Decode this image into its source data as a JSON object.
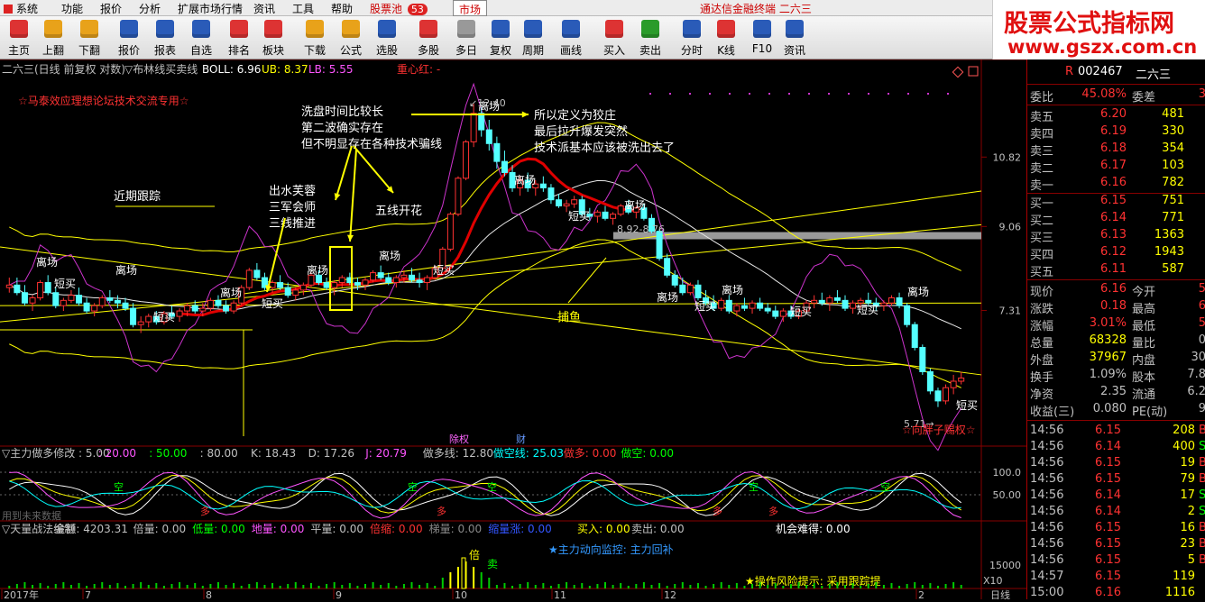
{
  "menu": {
    "items": [
      "系统",
      "功能",
      "报价",
      "分析",
      "扩展市场行情",
      "资讯",
      "工具",
      "帮助"
    ],
    "pool_label": "股票池",
    "pool_badge": "53",
    "market_tab": "市场",
    "window_title": "通达信金融终端 二六三"
  },
  "brand": {
    "title": "股票公式指标网",
    "url": "www.gszx.com.cn"
  },
  "toolbar": [
    {
      "label": "主页",
      "icon": "home-icon",
      "color": "#d33"
    },
    {
      "label": "上翻",
      "icon": "arrow-up-icon",
      "color": "#e8a21a"
    },
    {
      "label": "下翻",
      "icon": "arrow-down-icon",
      "color": "#e8a21a"
    },
    {
      "label": "报价",
      "icon": "quote-icon",
      "color": "#2a5bb8"
    },
    {
      "label": "报表",
      "icon": "report-icon",
      "color": "#2a5bb8"
    },
    {
      "label": "自选",
      "icon": "f6-icon",
      "color": "#2a5bb8"
    },
    {
      "label": "排名",
      "icon": "rank-icon",
      "color": "#d33"
    },
    {
      "label": "板块",
      "icon": "sector-icon",
      "color": "#d33"
    },
    {
      "label": "下载",
      "icon": "download-icon",
      "color": "#e8a21a"
    },
    {
      "label": "公式",
      "icon": "formula-icon",
      "color": "#e8a21a"
    },
    {
      "label": "选股",
      "icon": "stock-select-icon",
      "color": "#2a5bb8"
    },
    {
      "label": "多股",
      "icon": "multi-stock-icon",
      "color": "#d33"
    },
    {
      "label": "多日",
      "icon": "multi-day-icon",
      "color": "#999"
    },
    {
      "label": "复权",
      "icon": "restore-right-icon",
      "color": "#2a5bb8"
    },
    {
      "label": "周期",
      "icon": "f8-icon",
      "color": "#2a5bb8"
    },
    {
      "label": "画线",
      "icon": "draw-line-icon",
      "color": "#2a5bb8"
    },
    {
      "label": "买入",
      "icon": "buy-icon",
      "color": "#d33"
    },
    {
      "label": "卖出",
      "icon": "sell-icon",
      "color": "#2a9b2a"
    },
    {
      "label": "分时",
      "icon": "intraday-icon",
      "color": "#2a5bb8"
    },
    {
      "label": "K线",
      "icon": "kline-icon",
      "color": "#d33"
    },
    {
      "label": "F10",
      "icon": "f10-icon",
      "color": "#2a5bb8"
    },
    {
      "label": "资讯",
      "icon": "news-icon",
      "color": "#2a5bb8"
    }
  ],
  "main_chart": {
    "header": {
      "title": "二六三(日线 前复权 对数)",
      "indicator": "▽布林线买卖线",
      "boll": "BOLL: 6.96",
      "ub": "UB: 8.37",
      "lb": "LB: 5.55",
      "center": "重心红: -"
    },
    "watermark": "☆马泰效应理想论坛技术交流专用☆",
    "price_labels": [
      "10.82",
      "9.06",
      "7.31"
    ],
    "annotations": [
      "洗盘时间比较长",
      "第二波确实存在",
      "但不明显存在各种技术骗线",
      "所以定义为狡庄",
      "最后拉升爆发突然",
      "技术派基本应该被洗出去了",
      "近期跟踪",
      "出水芙蓉",
      "三军会师",
      "三线推进",
      "五线开花",
      "捕鱼"
    ],
    "high_label": "12.40",
    "range_label": "8.92-8.76",
    "low_label": "5.71",
    "bottom_tag": "☆向胖子赐权☆",
    "signal_sell": "离场",
    "signal_buy": "短买",
    "event_marks": [
      "除权",
      "财"
    ]
  },
  "chart_data": {
    "type": "candlestick",
    "title": "二六三(日线 前复权 对数)",
    "y_ticks": [
      10.82,
      9.06,
      7.31
    ],
    "candles": [
      {
        "o": 7.75,
        "h": 7.95,
        "l": 7.65,
        "c": 7.8
      },
      {
        "o": 7.8,
        "h": 7.95,
        "l": 7.6,
        "c": 7.65
      },
      {
        "o": 7.65,
        "h": 7.8,
        "l": 7.4,
        "c": 7.45
      },
      {
        "o": 7.45,
        "h": 7.6,
        "l": 7.3,
        "c": 7.55
      },
      {
        "o": 7.55,
        "h": 7.9,
        "l": 7.5,
        "c": 7.85
      },
      {
        "o": 7.85,
        "h": 8.0,
        "l": 7.6,
        "c": 7.65
      },
      {
        "o": 7.65,
        "h": 7.75,
        "l": 7.35,
        "c": 7.4
      },
      {
        "o": 7.4,
        "h": 7.55,
        "l": 7.3,
        "c": 7.5
      },
      {
        "o": 7.5,
        "h": 7.7,
        "l": 7.45,
        "c": 7.6
      },
      {
        "o": 7.6,
        "h": 7.75,
        "l": 7.4,
        "c": 7.45
      },
      {
        "o": 7.45,
        "h": 7.55,
        "l": 7.25,
        "c": 7.3
      },
      {
        "o": 7.3,
        "h": 7.45,
        "l": 7.2,
        "c": 7.4
      },
      {
        "o": 7.4,
        "h": 7.6,
        "l": 7.35,
        "c": 7.55
      },
      {
        "o": 7.55,
        "h": 7.7,
        "l": 7.45,
        "c": 7.5
      },
      {
        "o": 7.5,
        "h": 7.6,
        "l": 7.35,
        "c": 7.45
      },
      {
        "o": 7.45,
        "h": 7.55,
        "l": 7.3,
        "c": 7.35
      },
      {
        "o": 7.35,
        "h": 7.45,
        "l": 7.0,
        "c": 7.05
      },
      {
        "o": 7.05,
        "h": 7.2,
        "l": 6.9,
        "c": 7.1
      },
      {
        "o": 7.1,
        "h": 7.25,
        "l": 7.0,
        "c": 7.2
      },
      {
        "o": 7.2,
        "h": 7.3,
        "l": 7.05,
        "c": 7.1
      },
      {
        "o": 7.1,
        "h": 7.3,
        "l": 7.05,
        "c": 7.25
      },
      {
        "o": 7.25,
        "h": 7.4,
        "l": 7.15,
        "c": 7.2
      },
      {
        "o": 7.2,
        "h": 7.35,
        "l": 7.1,
        "c": 7.3
      },
      {
        "o": 7.3,
        "h": 7.45,
        "l": 7.2,
        "c": 7.4
      },
      {
        "o": 7.4,
        "h": 7.5,
        "l": 7.25,
        "c": 7.3
      },
      {
        "o": 7.3,
        "h": 7.45,
        "l": 7.2,
        "c": 7.35
      },
      {
        "o": 7.35,
        "h": 7.55,
        "l": 7.3,
        "c": 7.5
      },
      {
        "o": 7.5,
        "h": 7.6,
        "l": 7.35,
        "c": 7.4
      },
      {
        "o": 7.4,
        "h": 7.5,
        "l": 7.25,
        "c": 7.3
      },
      {
        "o": 7.3,
        "h": 7.5,
        "l": 7.25,
        "c": 7.45
      },
      {
        "o": 7.45,
        "h": 7.8,
        "l": 7.4,
        "c": 7.75
      },
      {
        "o": 7.75,
        "h": 8.15,
        "l": 7.7,
        "c": 8.1
      },
      {
        "o": 8.1,
        "h": 8.25,
        "l": 7.9,
        "c": 7.95
      },
      {
        "o": 7.95,
        "h": 8.05,
        "l": 7.7,
        "c": 7.75
      },
      {
        "o": 7.75,
        "h": 7.9,
        "l": 7.65,
        "c": 7.85
      },
      {
        "o": 7.85,
        "h": 8.0,
        "l": 7.7,
        "c": 7.75
      },
      {
        "o": 7.75,
        "h": 7.85,
        "l": 7.55,
        "c": 7.6
      },
      {
        "o": 7.6,
        "h": 7.75,
        "l": 7.5,
        "c": 7.7
      },
      {
        "o": 7.7,
        "h": 7.85,
        "l": 7.6,
        "c": 7.8
      },
      {
        "o": 7.8,
        "h": 8.05,
        "l": 7.75,
        "c": 8.0
      },
      {
        "o": 8.0,
        "h": 8.1,
        "l": 7.8,
        "c": 7.85
      },
      {
        "o": 7.85,
        "h": 7.95,
        "l": 7.7,
        "c": 7.75
      },
      {
        "o": 7.75,
        "h": 7.9,
        "l": 7.6,
        "c": 7.85
      },
      {
        "o": 7.85,
        "h": 8.0,
        "l": 7.75,
        "c": 7.95
      },
      {
        "o": 7.95,
        "h": 8.05,
        "l": 7.8,
        "c": 7.85
      },
      {
        "o": 7.85,
        "h": 7.95,
        "l": 7.7,
        "c": 7.8
      },
      {
        "o": 7.8,
        "h": 7.95,
        "l": 7.7,
        "c": 7.9
      },
      {
        "o": 7.9,
        "h": 8.1,
        "l": 7.85,
        "c": 8.05
      },
      {
        "o": 8.05,
        "h": 8.2,
        "l": 7.9,
        "c": 7.95
      },
      {
        "o": 7.95,
        "h": 8.05,
        "l": 7.8,
        "c": 7.85
      },
      {
        "o": 7.85,
        "h": 8.0,
        "l": 7.75,
        "c": 7.95
      },
      {
        "o": 7.95,
        "h": 8.1,
        "l": 7.85,
        "c": 8.0
      },
      {
        "o": 8.0,
        "h": 8.15,
        "l": 7.85,
        "c": 7.9
      },
      {
        "o": 7.9,
        "h": 8.05,
        "l": 7.75,
        "c": 7.85
      },
      {
        "o": 7.85,
        "h": 8.0,
        "l": 7.7,
        "c": 7.95
      },
      {
        "o": 7.95,
        "h": 8.2,
        "l": 7.9,
        "c": 8.15
      },
      {
        "o": 8.15,
        "h": 8.6,
        "l": 8.1,
        "c": 8.55
      },
      {
        "o": 8.55,
        "h": 9.4,
        "l": 8.5,
        "c": 9.35
      },
      {
        "o": 9.35,
        "h": 10.3,
        "l": 9.3,
        "c": 10.25
      },
      {
        "o": 10.25,
        "h": 11.3,
        "l": 10.2,
        "c": 11.25
      },
      {
        "o": 11.25,
        "h": 12.4,
        "l": 11.1,
        "c": 12.1
      },
      {
        "o": 12.1,
        "h": 12.3,
        "l": 11.4,
        "c": 11.6
      },
      {
        "o": 11.6,
        "h": 11.9,
        "l": 11.0,
        "c": 11.2
      },
      {
        "o": 11.2,
        "h": 11.4,
        "l": 10.5,
        "c": 10.7
      },
      {
        "o": 10.7,
        "h": 11.0,
        "l": 10.3,
        "c": 10.4
      },
      {
        "o": 10.4,
        "h": 10.6,
        "l": 9.9,
        "c": 10.0
      },
      {
        "o": 10.0,
        "h": 10.3,
        "l": 9.8,
        "c": 10.2
      },
      {
        "o": 10.2,
        "h": 10.4,
        "l": 9.9,
        "c": 10.0
      },
      {
        "o": 10.0,
        "h": 10.2,
        "l": 9.8,
        "c": 10.1
      },
      {
        "o": 10.1,
        "h": 10.3,
        "l": 9.9,
        "c": 10.0
      },
      {
        "o": 10.0,
        "h": 10.1,
        "l": 9.6,
        "c": 9.7
      },
      {
        "o": 9.7,
        "h": 9.85,
        "l": 9.5,
        "c": 9.55
      },
      {
        "o": 9.55,
        "h": 9.7,
        "l": 9.4,
        "c": 9.6
      },
      {
        "o": 9.6,
        "h": 9.8,
        "l": 9.5,
        "c": 9.7
      },
      {
        "o": 9.7,
        "h": 9.8,
        "l": 9.3,
        "c": 9.35
      },
      {
        "o": 9.35,
        "h": 9.5,
        "l": 9.2,
        "c": 9.3
      },
      {
        "o": 9.3,
        "h": 9.45,
        "l": 9.15,
        "c": 9.4
      },
      {
        "o": 9.4,
        "h": 9.55,
        "l": 9.2,
        "c": 9.25
      },
      {
        "o": 9.25,
        "h": 9.4,
        "l": 9.1,
        "c": 9.35
      },
      {
        "o": 9.35,
        "h": 9.6,
        "l": 9.3,
        "c": 9.55
      },
      {
        "o": 9.55,
        "h": 9.7,
        "l": 9.35,
        "c": 9.4
      },
      {
        "o": 9.4,
        "h": 9.55,
        "l": 9.25,
        "c": 9.5
      },
      {
        "o": 9.5,
        "h": 9.6,
        "l": 9.2,
        "c": 9.25
      },
      {
        "o": 9.25,
        "h": 9.35,
        "l": 8.9,
        "c": 8.95
      },
      {
        "o": 8.95,
        "h": 9.0,
        "l": 8.3,
        "c": 8.35
      },
      {
        "o": 8.35,
        "h": 8.45,
        "l": 7.95,
        "c": 8.0
      },
      {
        "o": 8.0,
        "h": 8.1,
        "l": 7.75,
        "c": 7.8
      },
      {
        "o": 7.8,
        "h": 7.95,
        "l": 7.6,
        "c": 7.65
      },
      {
        "o": 7.65,
        "h": 7.85,
        "l": 7.6,
        "c": 7.8
      },
      {
        "o": 7.8,
        "h": 7.9,
        "l": 7.5,
        "c": 7.55
      },
      {
        "o": 7.55,
        "h": 7.7,
        "l": 7.4,
        "c": 7.45
      },
      {
        "o": 7.45,
        "h": 7.6,
        "l": 7.3,
        "c": 7.35
      },
      {
        "o": 7.35,
        "h": 7.55,
        "l": 7.3,
        "c": 7.5
      },
      {
        "o": 7.5,
        "h": 7.6,
        "l": 7.25,
        "c": 7.3
      },
      {
        "o": 7.3,
        "h": 7.45,
        "l": 7.2,
        "c": 7.4
      },
      {
        "o": 7.4,
        "h": 7.55,
        "l": 7.3,
        "c": 7.35
      },
      {
        "o": 7.35,
        "h": 7.5,
        "l": 7.25,
        "c": 7.45
      },
      {
        "o": 7.45,
        "h": 7.55,
        "l": 7.3,
        "c": 7.35
      },
      {
        "o": 7.35,
        "h": 7.45,
        "l": 7.25,
        "c": 7.3
      },
      {
        "o": 7.3,
        "h": 7.4,
        "l": 7.15,
        "c": 7.2
      },
      {
        "o": 7.2,
        "h": 7.35,
        "l": 7.1,
        "c": 7.3
      },
      {
        "o": 7.3,
        "h": 7.4,
        "l": 7.15,
        "c": 7.2
      },
      {
        "o": 7.2,
        "h": 7.35,
        "l": 7.15,
        "c": 7.3
      },
      {
        "o": 7.3,
        "h": 7.5,
        "l": 7.25,
        "c": 7.45
      },
      {
        "o": 7.45,
        "h": 7.6,
        "l": 7.35,
        "c": 7.5
      },
      {
        "o": 7.5,
        "h": 7.65,
        "l": 7.4,
        "c": 7.45
      },
      {
        "o": 7.45,
        "h": 7.6,
        "l": 7.3,
        "c": 7.55
      },
      {
        "o": 7.55,
        "h": 7.7,
        "l": 7.45,
        "c": 7.5
      },
      {
        "o": 7.5,
        "h": 7.6,
        "l": 7.3,
        "c": 7.35
      },
      {
        "o": 7.35,
        "h": 7.5,
        "l": 7.25,
        "c": 7.45
      },
      {
        "o": 7.45,
        "h": 7.55,
        "l": 7.35,
        "c": 7.5
      },
      {
        "o": 7.5,
        "h": 7.65,
        "l": 7.4,
        "c": 7.45
      },
      {
        "o": 7.45,
        "h": 7.55,
        "l": 7.3,
        "c": 7.4
      },
      {
        "o": 7.4,
        "h": 7.5,
        "l": 7.3,
        "c": 7.45
      },
      {
        "o": 7.45,
        "h": 7.6,
        "l": 7.4,
        "c": 7.55
      },
      {
        "o": 7.55,
        "h": 7.65,
        "l": 7.35,
        "c": 7.4
      },
      {
        "o": 7.4,
        "h": 7.45,
        "l": 7.0,
        "c": 7.05
      },
      {
        "o": 7.05,
        "h": 7.1,
        "l": 6.6,
        "c": 6.65
      },
      {
        "o": 6.65,
        "h": 6.7,
        "l": 6.2,
        "c": 6.25
      },
      {
        "o": 6.25,
        "h": 6.3,
        "l": 5.9,
        "c": 5.95
      },
      {
        "o": 5.95,
        "h": 6.0,
        "l": 5.71,
        "c": 5.8
      },
      {
        "o": 5.8,
        "h": 6.05,
        "l": 5.75,
        "c": 6.0
      },
      {
        "o": 6.0,
        "h": 6.2,
        "l": 5.9,
        "c": 6.1
      },
      {
        "o": 6.1,
        "h": 6.25,
        "l": 6.05,
        "c": 6.15
      }
    ]
  },
  "sub1": {
    "title": "▽主力做多修改 : 5.00",
    "v1": ": 20.00",
    "v2": ": 50.00",
    "v3": ": 80.00",
    "k": "K: 18.43",
    "d": "D: 17.26",
    "j": "J: 20.79",
    "do_line": "做多线: 12.80",
    "kong_line": "做空线: 25.03",
    "zuoduo": "做多: 0.00",
    "zuokong": "做空: 0.00",
    "ticks": [
      "100.0",
      "50.00"
    ],
    "marks": [
      "空",
      "多"
    ],
    "note": "用到未来数据"
  },
  "sub2": {
    "title": "▽天量战法编制",
    "amount": "金额: 4203.31",
    "beiliang": "倍量: 0.00",
    "diliang": "低量: 0.00",
    "diliang2": "地量: 0.00",
    "pingliang": "平量: 0.00",
    "beisuo": "倍缩: 0.00",
    "tiliang": "梯量: 0.00",
    "suoliang": "缩量涨: 0.00",
    "buy": "买入: 0.00",
    "sell": "卖出: 0.00",
    "chance": "机会难得: 0.00",
    "monitor": "★主力动向监控: 主力回补",
    "risk": "★操作风险提示: 采用跟踪提",
    "tick": "15000",
    "zoom": "X10",
    "bei": "倍",
    "mai": "卖"
  },
  "axis": {
    "dates": [
      "2017年",
      "7",
      "8",
      "9",
      "10",
      "11",
      "12",
      "2"
    ],
    "period": "日线"
  },
  "quote": {
    "code": "002467",
    "name": "二六三",
    "ratio_label": "委比",
    "ratio_value": "45.08%",
    "diff_label": "委差",
    "diff_value": "3",
    "asks": [
      {
        "label": "卖五",
        "price": "6.20",
        "vol": "481"
      },
      {
        "label": "卖四",
        "price": "6.19",
        "vol": "330"
      },
      {
        "label": "卖三",
        "price": "6.18",
        "vol": "354"
      },
      {
        "label": "卖二",
        "price": "6.17",
        "vol": "103"
      },
      {
        "label": "卖一",
        "price": "6.16",
        "vol": "782"
      }
    ],
    "bids": [
      {
        "label": "买一",
        "price": "6.15",
        "vol": "751"
      },
      {
        "label": "买二",
        "price": "6.14",
        "vol": "771"
      },
      {
        "label": "买三",
        "price": "6.13",
        "vol": "1363"
      },
      {
        "label": "买四",
        "price": "6.12",
        "vol": "1943"
      },
      {
        "label": "买五",
        "price": "6.11",
        "vol": "587"
      }
    ],
    "stats": [
      {
        "l1": "现价",
        "v1": "6.16",
        "l2": "今开",
        "v2": "5"
      },
      {
        "l1": "涨跌",
        "v1": "0.18",
        "l2": "最高",
        "v2": "6"
      },
      {
        "l1": "涨幅",
        "v1": "3.01%",
        "l2": "最低",
        "v2": "5"
      },
      {
        "l1": "总量",
        "v1": "68328",
        "l2": "量比",
        "v2": "0"
      },
      {
        "l1": "外盘",
        "v1": "37967",
        "l2": "内盘",
        "v2": "30"
      },
      {
        "l1": "换手",
        "v1": "1.09%",
        "l2": "股本",
        "v2": "7.8"
      },
      {
        "l1": "净资",
        "v1": "2.35",
        "l2": "流通",
        "v2": "6.2"
      },
      {
        "l1": "收益(三)",
        "v1": "0.080",
        "l2": "PE(动)",
        "v2": "9"
      }
    ],
    "ticks": [
      {
        "t": "14:56",
        "p": "6.15",
        "v": "208",
        "s": "B"
      },
      {
        "t": "14:56",
        "p": "6.14",
        "v": "400",
        "s": "S"
      },
      {
        "t": "14:56",
        "p": "6.15",
        "v": "19",
        "s": "B"
      },
      {
        "t": "14:56",
        "p": "6.15",
        "v": "79",
        "s": "B"
      },
      {
        "t": "14:56",
        "p": "6.14",
        "v": "17",
        "s": "S"
      },
      {
        "t": "14:56",
        "p": "6.14",
        "v": "2",
        "s": "S"
      },
      {
        "t": "14:56",
        "p": "6.15",
        "v": "16",
        "s": "B"
      },
      {
        "t": "14:56",
        "p": "6.15",
        "v": "23",
        "s": "B"
      },
      {
        "t": "14:56",
        "p": "6.15",
        "v": "5",
        "s": "B"
      },
      {
        "t": "14:57",
        "p": "6.15",
        "v": "119",
        "s": ""
      },
      {
        "t": "15:00",
        "p": "6.16",
        "v": "1116",
        "s": ""
      }
    ]
  },
  "colors": {
    "up": "#ff3232",
    "down": "#54ffff",
    "ma": "#ffff00",
    "purple": "#cc33cc",
    "red_line": "#e00000",
    "text": "#c0c0c0",
    "yellow": "#ffff00",
    "green": "#00ff00",
    "cyan": "#00ffff"
  }
}
